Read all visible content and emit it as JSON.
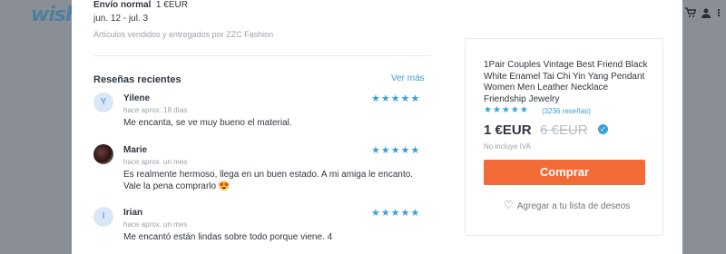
{
  "background": {
    "logo": "wish",
    "icons": [
      "cart-icon",
      "user-icon",
      "more-icon"
    ]
  },
  "shipping": {
    "label": "Envío normal",
    "price": "1 €EUR",
    "dates": "jun. 12 - jul. 3",
    "seller": "Artículos vendidos y entregados por ZZC Fashion"
  },
  "reviews": {
    "title": "Reseñas recientes",
    "see_more": "Ver más",
    "stars": "★★★★★",
    "items": [
      {
        "name": "Yilene",
        "initial": "Y",
        "time": "hace aprox. 18 días",
        "text": "Me encanta, se ve muy bueno el material.",
        "rating": 5
      },
      {
        "name": "Marie",
        "initial": "",
        "time": "hace aprox. un mes",
        "text": "Es realmente hermoso, llega en un buen estado. A mi amiga le encanto. Vale la pena comprarlo 😍",
        "rating": 5
      },
      {
        "name": "Irian",
        "initial": "I",
        "time": "hace aprox. un mes",
        "text": "Me encantó están lindas sobre todo porque viene. 4",
        "rating": 5
      }
    ]
  },
  "product": {
    "title": "1Pair Couples Vintage Best Friend Black White Enamel Tai Chi Yin Yang Pendant Women Men Leather Necklace Friendship Jewelry",
    "stars": "★★★★★",
    "rating": 4.5,
    "rating_count": "(3236 reseñas)",
    "price": "1 €EUR",
    "old_price": "6 €EUR",
    "tax_note": "No incluye IVA",
    "buy_label": "Comprar",
    "wishlist_label": "Agregar a tu lista de deseos"
  },
  "colors": {
    "accent": "#3aa0d8",
    "buy_button": "#f26a36"
  }
}
